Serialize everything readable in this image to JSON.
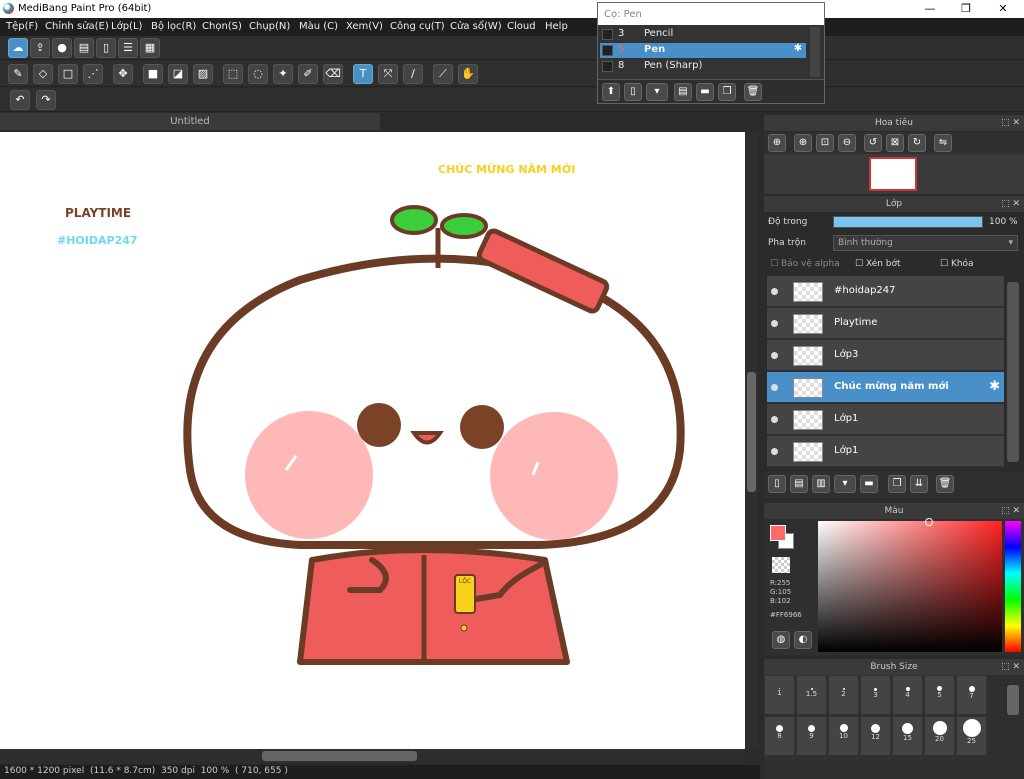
{
  "window": {
    "title": "MediBang Paint Pro (64bit)",
    "min": "—",
    "max": "❐",
    "close": "✕"
  },
  "menu": [
    "Tệp(F)",
    "Chỉnh sửa(E)",
    "Lớp(L)",
    "Bộ lọc(R)",
    "Chọn(S)",
    "Chụp(N)",
    "Màu (C)",
    "Xem(V)",
    "Công cụ(T)",
    "Cửa sổ(W)",
    "Cloud",
    "Help"
  ],
  "pen_popup": {
    "title": "Cọ: Pen",
    "items": [
      {
        "num": "3",
        "name": "Pencil"
      },
      {
        "num": "5",
        "name": "Pen"
      },
      {
        "num": "8",
        "name": "Pen (Sharp)"
      }
    ]
  },
  "doc_tab": "Untitled",
  "canvas_texts": {
    "playtime": "PLAYTIME",
    "hashtag": "#HOIDAP247",
    "greeting": "CHÚC MỪNG NĂM MỚI",
    "amulet": "LỘC"
  },
  "status": {
    "size": "1600 * 1200 pixel",
    "phys": "(11.6 * 8.7cm)",
    "dpi": "350 dpi",
    "zoom": "100 %",
    "coords": "( 710, 655 )"
  },
  "navigator": {
    "title": "Hoa tiêu"
  },
  "layers_panel": {
    "title": "Lớp",
    "opacity_label": "Độ trong",
    "opacity_value": "100 %",
    "opacity": 1.0,
    "blend_label": "Pha trộn",
    "blend_value": "Bình thường",
    "protect_alpha": "Bảo vệ alpha",
    "clipping": "Xén bớt",
    "lock": "Khóa",
    "layers": [
      "#hoidap247",
      "Playtime",
      "Lớp3",
      "Chúc mừng năm mới",
      "Lớp1",
      "Lớp1"
    ]
  },
  "color_panel": {
    "title": "Màu",
    "r": "R:255",
    "g": "G:105",
    "b": "B:102",
    "hex": "#FF6966",
    "fg": "#FF6966"
  },
  "brush_panel": {
    "title": "Brush Size",
    "sizes": [
      "1",
      "1.5",
      "2",
      "3",
      "4",
      "5",
      "7",
      "8",
      "9",
      "10",
      "12",
      "15",
      "20",
      "25"
    ]
  }
}
